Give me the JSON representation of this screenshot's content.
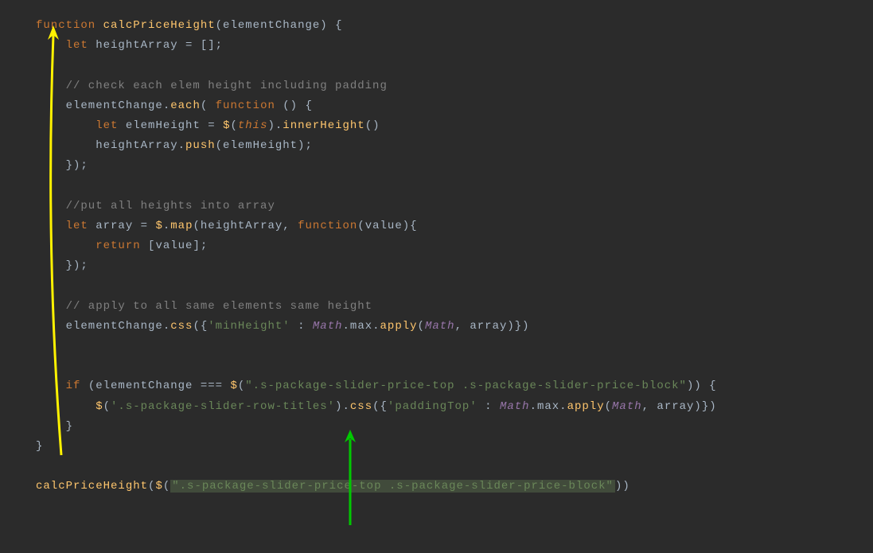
{
  "code": {
    "l1_kw": "function",
    "l1_fn": "calcPriceHeight",
    "l1_rest": "(elementChange) {",
    "l2_kw": "let",
    "l2_rest": " heightArray = [];",
    "l4": "    // check each elem height including padding",
    "l5_a": "    elementChange.",
    "l5_fn": "each",
    "l5_b": "( ",
    "l5_kw": "function",
    "l5_c": " () {",
    "l6_kw": "let",
    "l6_a": " elemHeight = ",
    "l6_dollar": "$",
    "l6_b": "(",
    "l6_this": "this",
    "l6_c": ").",
    "l6_fn": "innerHeight",
    "l6_d": "()",
    "l7_a": "        heightArray.",
    "l7_fn": "push",
    "l7_b": "(elemHeight);",
    "l8": "    });",
    "l10": "    //put all heights into array",
    "l11_kw": "let",
    "l11_a": " array = ",
    "l11_dollar": "$",
    "l11_b": ".",
    "l11_fn": "map",
    "l11_c": "(heightArray, ",
    "l11_kw2": "function",
    "l11_d": "(value){",
    "l12_kw": "return",
    "l12_a": " [value];",
    "l13": "    });",
    "l15": "    // apply to all same elements same height",
    "l16_a": "    elementChange.",
    "l16_fn": "css",
    "l16_b": "({",
    "l16_str": "'minHeight'",
    "l16_c": " : ",
    "l16_math": "Math",
    "l16_d": ".max.",
    "l16_fn2": "apply",
    "l16_e": "(",
    "l16_math2": "Math",
    "l16_f": ", array)})",
    "l19_kw": "if",
    "l19_a": " (elementChange === ",
    "l19_dollar": "$",
    "l19_b": "(",
    "l19_str": "\".s-package-slider-price-top .s-package-slider-price-block\"",
    "l19_c": ")) {",
    "l20_dollar": "$",
    "l20_a": "(",
    "l20_str1": "'.s-package-slider-row-titles'",
    "l20_b": ").",
    "l20_fn": "css",
    "l20_c": "({",
    "l20_str2": "'paddingTop'",
    "l20_d": " : ",
    "l20_math": "Math",
    "l20_e": ".max.",
    "l20_fn2": "apply",
    "l20_f": "(",
    "l20_math2": "Math",
    "l20_g": ", array)})",
    "l21": "    }",
    "l22": "}",
    "l24_fn": "calcPriceHeight",
    "l24_a": "(",
    "l24_dollar": "$",
    "l24_b": "(",
    "l24_str": "\".s-package-slider-price-top .s-package-slider-price-block\"",
    "l24_c": "))"
  }
}
